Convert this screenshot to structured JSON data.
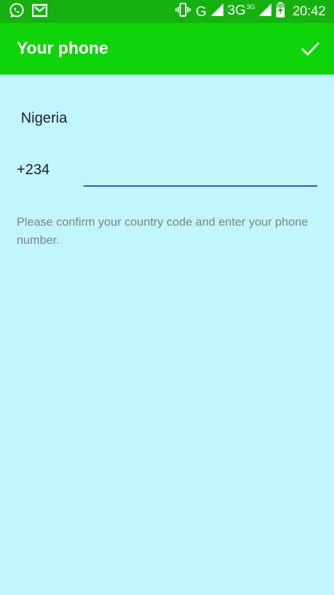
{
  "status_bar": {
    "network_type_1": "G",
    "network_type_2": "3G",
    "network_type_2_sup": "3G",
    "time": "20:42",
    "icons": [
      "whatsapp-icon",
      "gmail-icon",
      "vibrate-icon",
      "signal-icon",
      "signal-icon",
      "battery-charging-icon"
    ]
  },
  "app_bar": {
    "title": "Your phone",
    "confirm_icon": "check-icon"
  },
  "form": {
    "country": "Nigeria",
    "country_code": "+234",
    "phone_number": "",
    "phone_placeholder": ""
  },
  "hint": "Please confirm your country code and enter your phone number.",
  "colors": {
    "status_bar": "#16b111",
    "app_bar": "#10d40a",
    "background": "#c1f6fe",
    "focus_underline": "#2156b8",
    "hint_text": "#7c8486"
  }
}
